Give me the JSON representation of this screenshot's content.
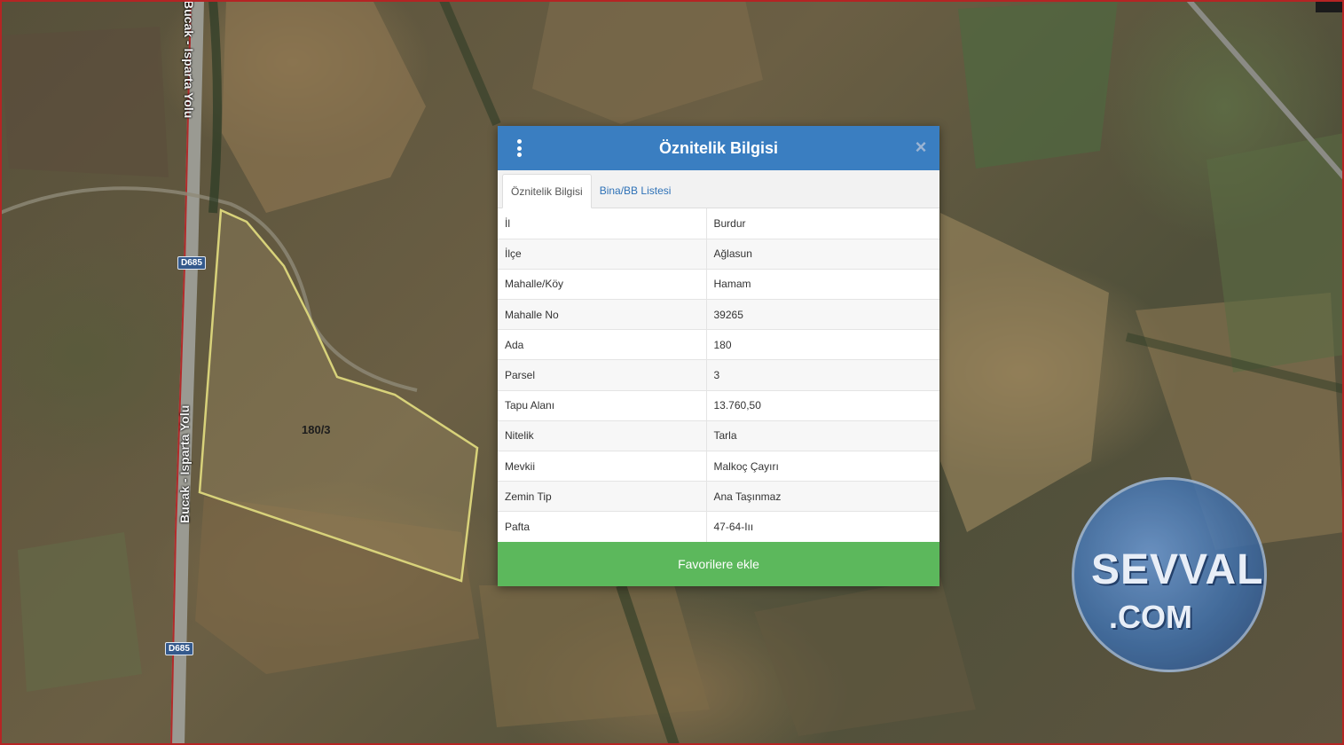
{
  "map": {
    "parcel_label": "180/3",
    "road_name": "Bucak - Isparta Yolu",
    "road_shields": [
      "D685",
      "D685"
    ]
  },
  "watermark": {
    "main": "SEVVAL",
    "sub": ".COM"
  },
  "dialog": {
    "title": "Öznitelik Bilgisi",
    "tabs": [
      {
        "label": "Öznitelik Bilgisi",
        "active": true
      },
      {
        "label": "Bina/BB Listesi",
        "active": false
      }
    ],
    "rows": [
      {
        "key": "İl",
        "value": "Burdur"
      },
      {
        "key": "İlçe",
        "value": "Ağlasun"
      },
      {
        "key": "Mahalle/Köy",
        "value": "Hamam"
      },
      {
        "key": "Mahalle No",
        "value": "39265"
      },
      {
        "key": "Ada",
        "value": "180"
      },
      {
        "key": "Parsel",
        "value": "3"
      },
      {
        "key": "Tapu Alanı",
        "value": "13.760,50"
      },
      {
        "key": "Nitelik",
        "value": "Tarla"
      },
      {
        "key": "Mevkii",
        "value": "Malkoç Çayırı"
      },
      {
        "key": "Zemin Tip",
        "value": "Ana Taşınmaz"
      },
      {
        "key": "Pafta",
        "value": "47-64-Iıı"
      }
    ],
    "favorite_label": "Favorilere ekle",
    "colors": {
      "header": "#3a7ec1",
      "button": "#5cb85c",
      "tab_link": "#2f72b7"
    }
  }
}
